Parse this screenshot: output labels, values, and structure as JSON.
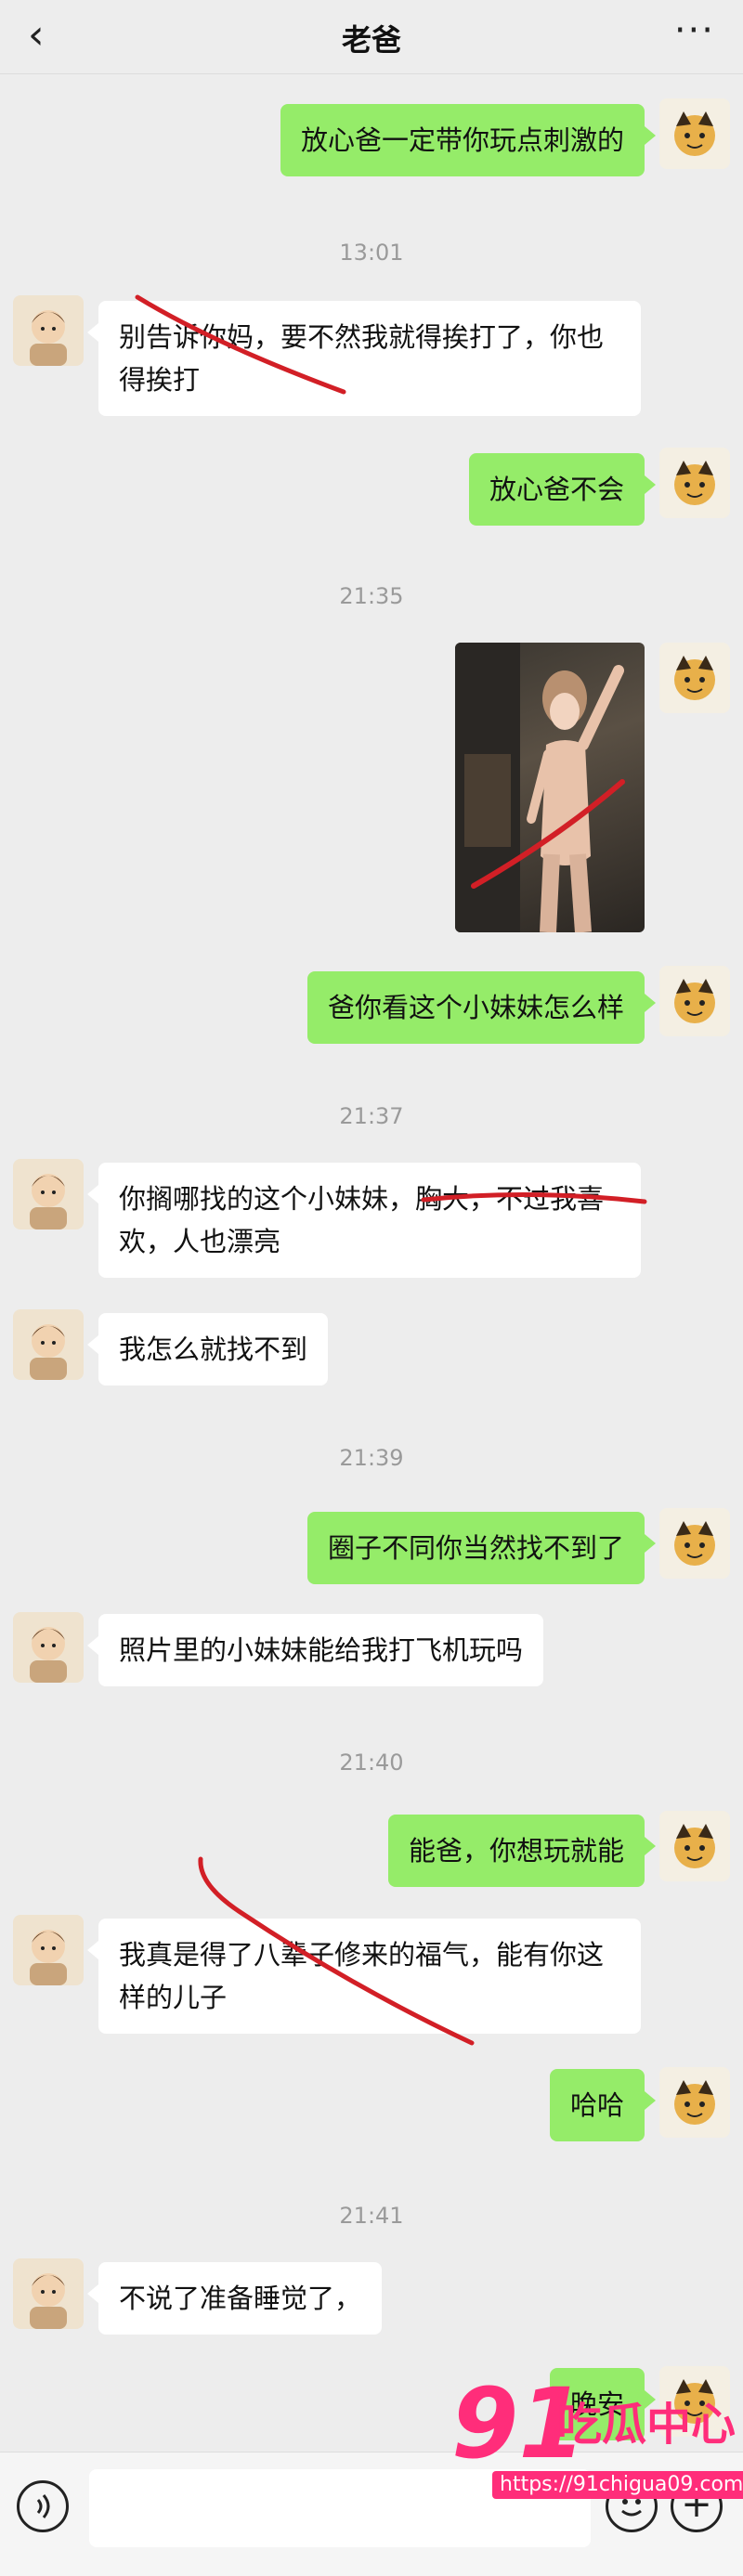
{
  "header": {
    "back_icon": "chevron-left-icon",
    "title": "老爸",
    "more_icon": "more-horizontal-icon"
  },
  "messages": [
    {
      "id": "m1",
      "from": "son",
      "text": "放心爸一定带你玩点刺激的"
    },
    {
      "id": "t1",
      "time": "13:01"
    },
    {
      "id": "m2",
      "from": "dad",
      "text": "别告诉你妈，要不然我就得挨打了，你也得挨打"
    },
    {
      "id": "m3",
      "from": "son",
      "text": "放心爸不会"
    },
    {
      "id": "t2",
      "time": "21:35"
    },
    {
      "id": "m4",
      "from": "son",
      "type": "image"
    },
    {
      "id": "m5",
      "from": "son",
      "text": "爸你看这个小妹妹怎么样"
    },
    {
      "id": "t3",
      "time": "21:37"
    },
    {
      "id": "m6",
      "from": "dad",
      "text": "你搁哪找的这个小妹妹，胸大，不过我喜欢，人也漂亮"
    },
    {
      "id": "m7",
      "from": "dad",
      "text": "我怎么就找不到"
    },
    {
      "id": "t4",
      "time": "21:39"
    },
    {
      "id": "m8",
      "from": "son",
      "text": "圈子不同你当然找不到了"
    },
    {
      "id": "m9",
      "from": "dad",
      "text": "照片里的小妹妹能给我打飞机玩吗"
    },
    {
      "id": "t5",
      "time": "21:40"
    },
    {
      "id": "m10",
      "from": "son",
      "text": "能爸，你想玩就能"
    },
    {
      "id": "m11",
      "from": "dad",
      "text": "我真是得了八辈子修来的福气，能有你这样的儿子"
    },
    {
      "id": "m12",
      "from": "son",
      "text": "哈哈"
    },
    {
      "id": "t6",
      "time": "21:41"
    },
    {
      "id": "m13",
      "from": "dad",
      "text": "不说了准备睡觉了，"
    },
    {
      "id": "m14",
      "from": "son",
      "text": "晚安"
    }
  ],
  "input_bar": {
    "voice_icon": "voice-icon",
    "emoji_icon": "emoji-icon",
    "plus_icon": "plus-icon"
  },
  "watermark": {
    "number": "91",
    "name": "吃瓜中心",
    "url": "https://91chigua09.com"
  },
  "colors": {
    "bubble_out": "#95ec69",
    "bubble_in": "#ffffff",
    "background": "#ededed",
    "watermark": "#ff2d7a",
    "annotation": "#d21f26"
  }
}
